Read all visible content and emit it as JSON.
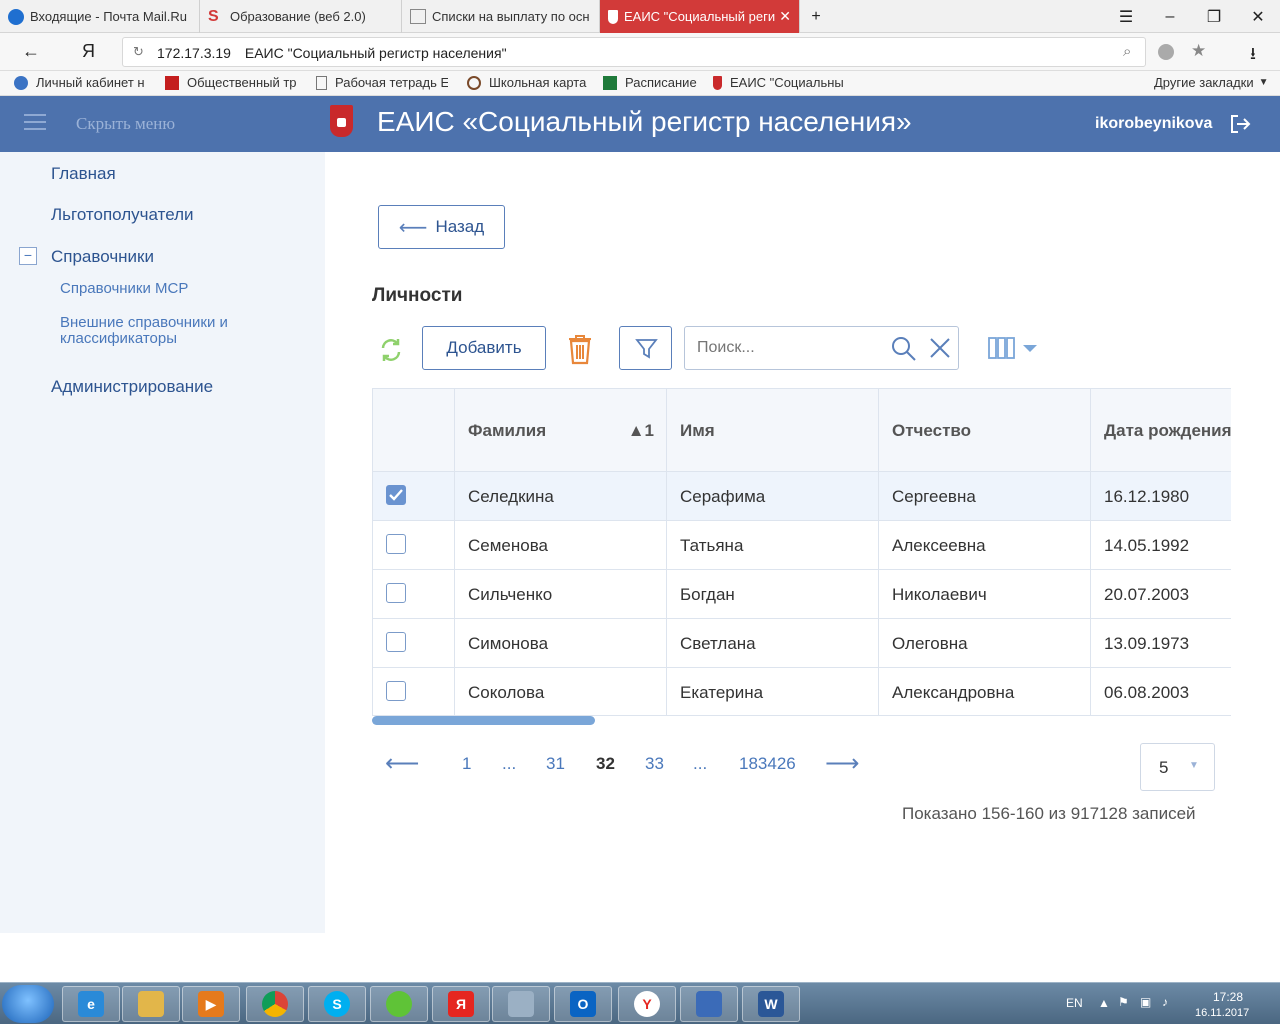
{
  "browser": {
    "tabs": [
      {
        "title": "Входящие - Почта Mail.Ru",
        "icon": "mail-icon",
        "active": false
      },
      {
        "title": "Образование (веб 2.0)",
        "icon": "s-logo-icon",
        "active": false
      },
      {
        "title": "Списки на выплату по осн",
        "icon": "page-icon",
        "active": false
      },
      {
        "title": "ЕАИС \"Социальный реги",
        "icon": "crest-icon",
        "active": true
      }
    ],
    "new_tab": "+",
    "window_controls": {
      "menu": "☰",
      "minimize": "–",
      "restore": "❐",
      "close": "✕"
    },
    "address": {
      "yandex_logo": "Я",
      "url": "172.17.3.19",
      "page_title": "ЕАИС \"Социальный регистр населения\""
    },
    "bookmarks": [
      {
        "label": "Личный кабинет н",
        "icon": "globe-icon"
      },
      {
        "label": "Общественный тр",
        "icon": "bus-icon"
      },
      {
        "label": "Рабочая тетрадь Е",
        "icon": "page-icon"
      },
      {
        "label": "Школьная карта",
        "icon": "card-icon"
      },
      {
        "label": "Расписание",
        "icon": "publisher-icon"
      },
      {
        "label": "ЕАИС \"Социальны",
        "icon": "crest-icon"
      }
    ],
    "other_bookmarks": "Другие закладки"
  },
  "header": {
    "hide_menu": "Скрыть меню",
    "title": "ЕАИС «Социальный регистр населения»",
    "user": "ikorobeynikova"
  },
  "sidebar": {
    "items": [
      {
        "label": "Главная"
      },
      {
        "label": "Льготополучатели"
      },
      {
        "label": "Справочники",
        "expanded": true,
        "toggle": "−"
      },
      {
        "label": "Администрирование"
      }
    ],
    "subitems": [
      {
        "label": "Справочники МСР"
      },
      {
        "label": "Внешние справочники и классификаторы"
      }
    ]
  },
  "main": {
    "back_label": "Назад",
    "page_title": "Личности",
    "add_label": "Добавить",
    "search_placeholder": "Поиск...",
    "columns": [
      "Фамилия",
      "Имя",
      "Отчество",
      "Дата рождения"
    ],
    "sort_indicator": "▲1",
    "rows": [
      {
        "checked": true,
        "surname": "Селедкина",
        "name": "Серафима",
        "patronymic": "Сергеевна",
        "dob": "16.12.1980"
      },
      {
        "checked": false,
        "surname": "Семенова",
        "name": "Татьяна",
        "patronymic": "Алексеевна",
        "dob": "14.05.1992"
      },
      {
        "checked": false,
        "surname": "Сильченко",
        "name": "Богдан",
        "patronymic": "Николаевич",
        "dob": "20.07.2003"
      },
      {
        "checked": false,
        "surname": "Симонова",
        "name": "Светлана",
        "patronymic": "Олеговна",
        "dob": "13.09.1973"
      },
      {
        "checked": false,
        "surname": "Соколова",
        "name": "Екатерина",
        "patronymic": "Александровна",
        "dob": "06.08.2003"
      }
    ],
    "pager": {
      "prev": "⟵",
      "next": "⟶",
      "pages": [
        "1",
        "...",
        "31",
        "32",
        "33",
        "...",
        "183426"
      ],
      "current": "32",
      "page_size": "5"
    },
    "shown_text": "Показано 156-160 из 917128 записей"
  },
  "taskbar": {
    "apps": [
      "ie-icon",
      "explorer-icon",
      "media-player-icon",
      "chrome-icon",
      "skype-icon",
      "icq-icon",
      "yandex-icon",
      "calculator-icon",
      "outlook-icon",
      "yandex-browser-icon",
      "network-icon",
      "word-icon"
    ],
    "lang": "EN",
    "time": "17:28",
    "date": "16.11.2017"
  },
  "colors": {
    "header": "#4d72ad",
    "active_tab": "#d23a39",
    "sidebar": "#f1f5fa",
    "link": "#4a78bb",
    "accent_orange": "#e8873a",
    "refresh_green": "#8fd16c"
  }
}
